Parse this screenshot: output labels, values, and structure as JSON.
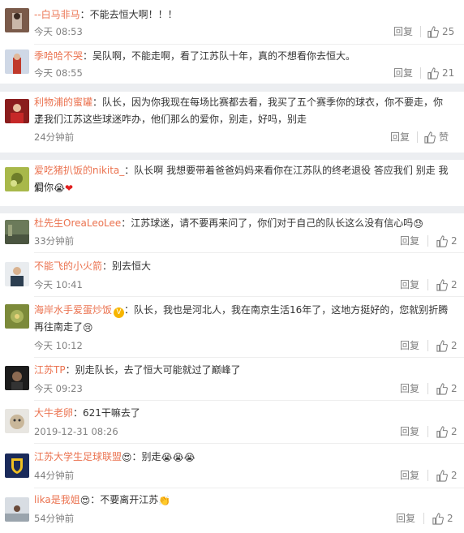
{
  "comments": [
    {
      "user": "--白马非马",
      "text": "：不能去恒大啊！！！",
      "time": "今天 08:53",
      "reply": "回复",
      "likes": "25"
    },
    {
      "user": "季哈哈不哭",
      "text": "：吴队啊，不能走啊，看了江苏队十年，真的不想看你去恒大。",
      "time": "今天 08:55",
      "reply": "回复",
      "likes": "21"
    },
    {
      "user": "利物浦的蜜罐",
      "text": "：队长，因为你我现在每场比赛都去看，我买了五个赛季你的球衣，你不要走，你走",
      "text2": "了我们江苏这些球迷咋办，他们那么的爱你，别走，好吗，别走",
      "time": "24分钟前",
      "reply": "回复",
      "likes": "赞"
    },
    {
      "user": "爱吃猪扒饭的nikita_",
      "text": "：队长啊 我想要带着爸爸妈妈来看你在江苏队的终老退役 答应我们 别走 我们",
      "text2": "爱你",
      "emoji_a": "😭",
      "emoji_b": "❤"
    },
    {
      "user": "杜先生OreaLeoLee",
      "text": "：江苏球迷，请不要再来问了，你们对于自己的队长这么没有信心吗",
      "emoji_a": "😓",
      "time": "33分钟前",
      "reply": "回复",
      "likes": "2"
    },
    {
      "user": "不能飞的小火箭",
      "text": "：别去恒大",
      "time": "今天 10:41",
      "reply": "回复",
      "likes": "2"
    },
    {
      "user": "海岸水手爱蛋炒饭",
      "verified": "V",
      "text": "：队长，我也是河北人，我在南京生活16年了，这地方挺好的，您就别折腾",
      "text2": "再往南走了",
      "emoji_a": "😢",
      "time": "今天 10:12",
      "reply": "回复",
      "likes": "2"
    },
    {
      "user": "江苏TP",
      "text": "：别走队长，去了恒大可能就过了巅峰了",
      "time": "今天 09:23",
      "reply": "回复",
      "likes": "2"
    },
    {
      "user": "大牛老卵",
      "text": "：621干嘛去了",
      "time": "2019-12-31 08:26",
      "reply": "回复",
      "likes": "2"
    },
    {
      "user": "江苏大学生足球联盟",
      "badge": "😍",
      "text": "：别走",
      "emoji_a": "😭",
      "emoji_b": "😭",
      "emoji_c": "😭",
      "time": "44分钟前",
      "reply": "回复",
      "likes": "2"
    },
    {
      "user": "lika是我姐",
      "badge": "😍",
      "text": "：不要离开江苏",
      "emoji_a": "👏",
      "time": "54分钟前",
      "reply": "回复",
      "likes": "2"
    }
  ],
  "colors": {
    "username": "#eb7350",
    "text": "#333333",
    "meta": "#808080",
    "separator": "#eceef1"
  },
  "icons": {
    "like": "thumbs-up-icon",
    "verified": "verified-badge-icon"
  }
}
